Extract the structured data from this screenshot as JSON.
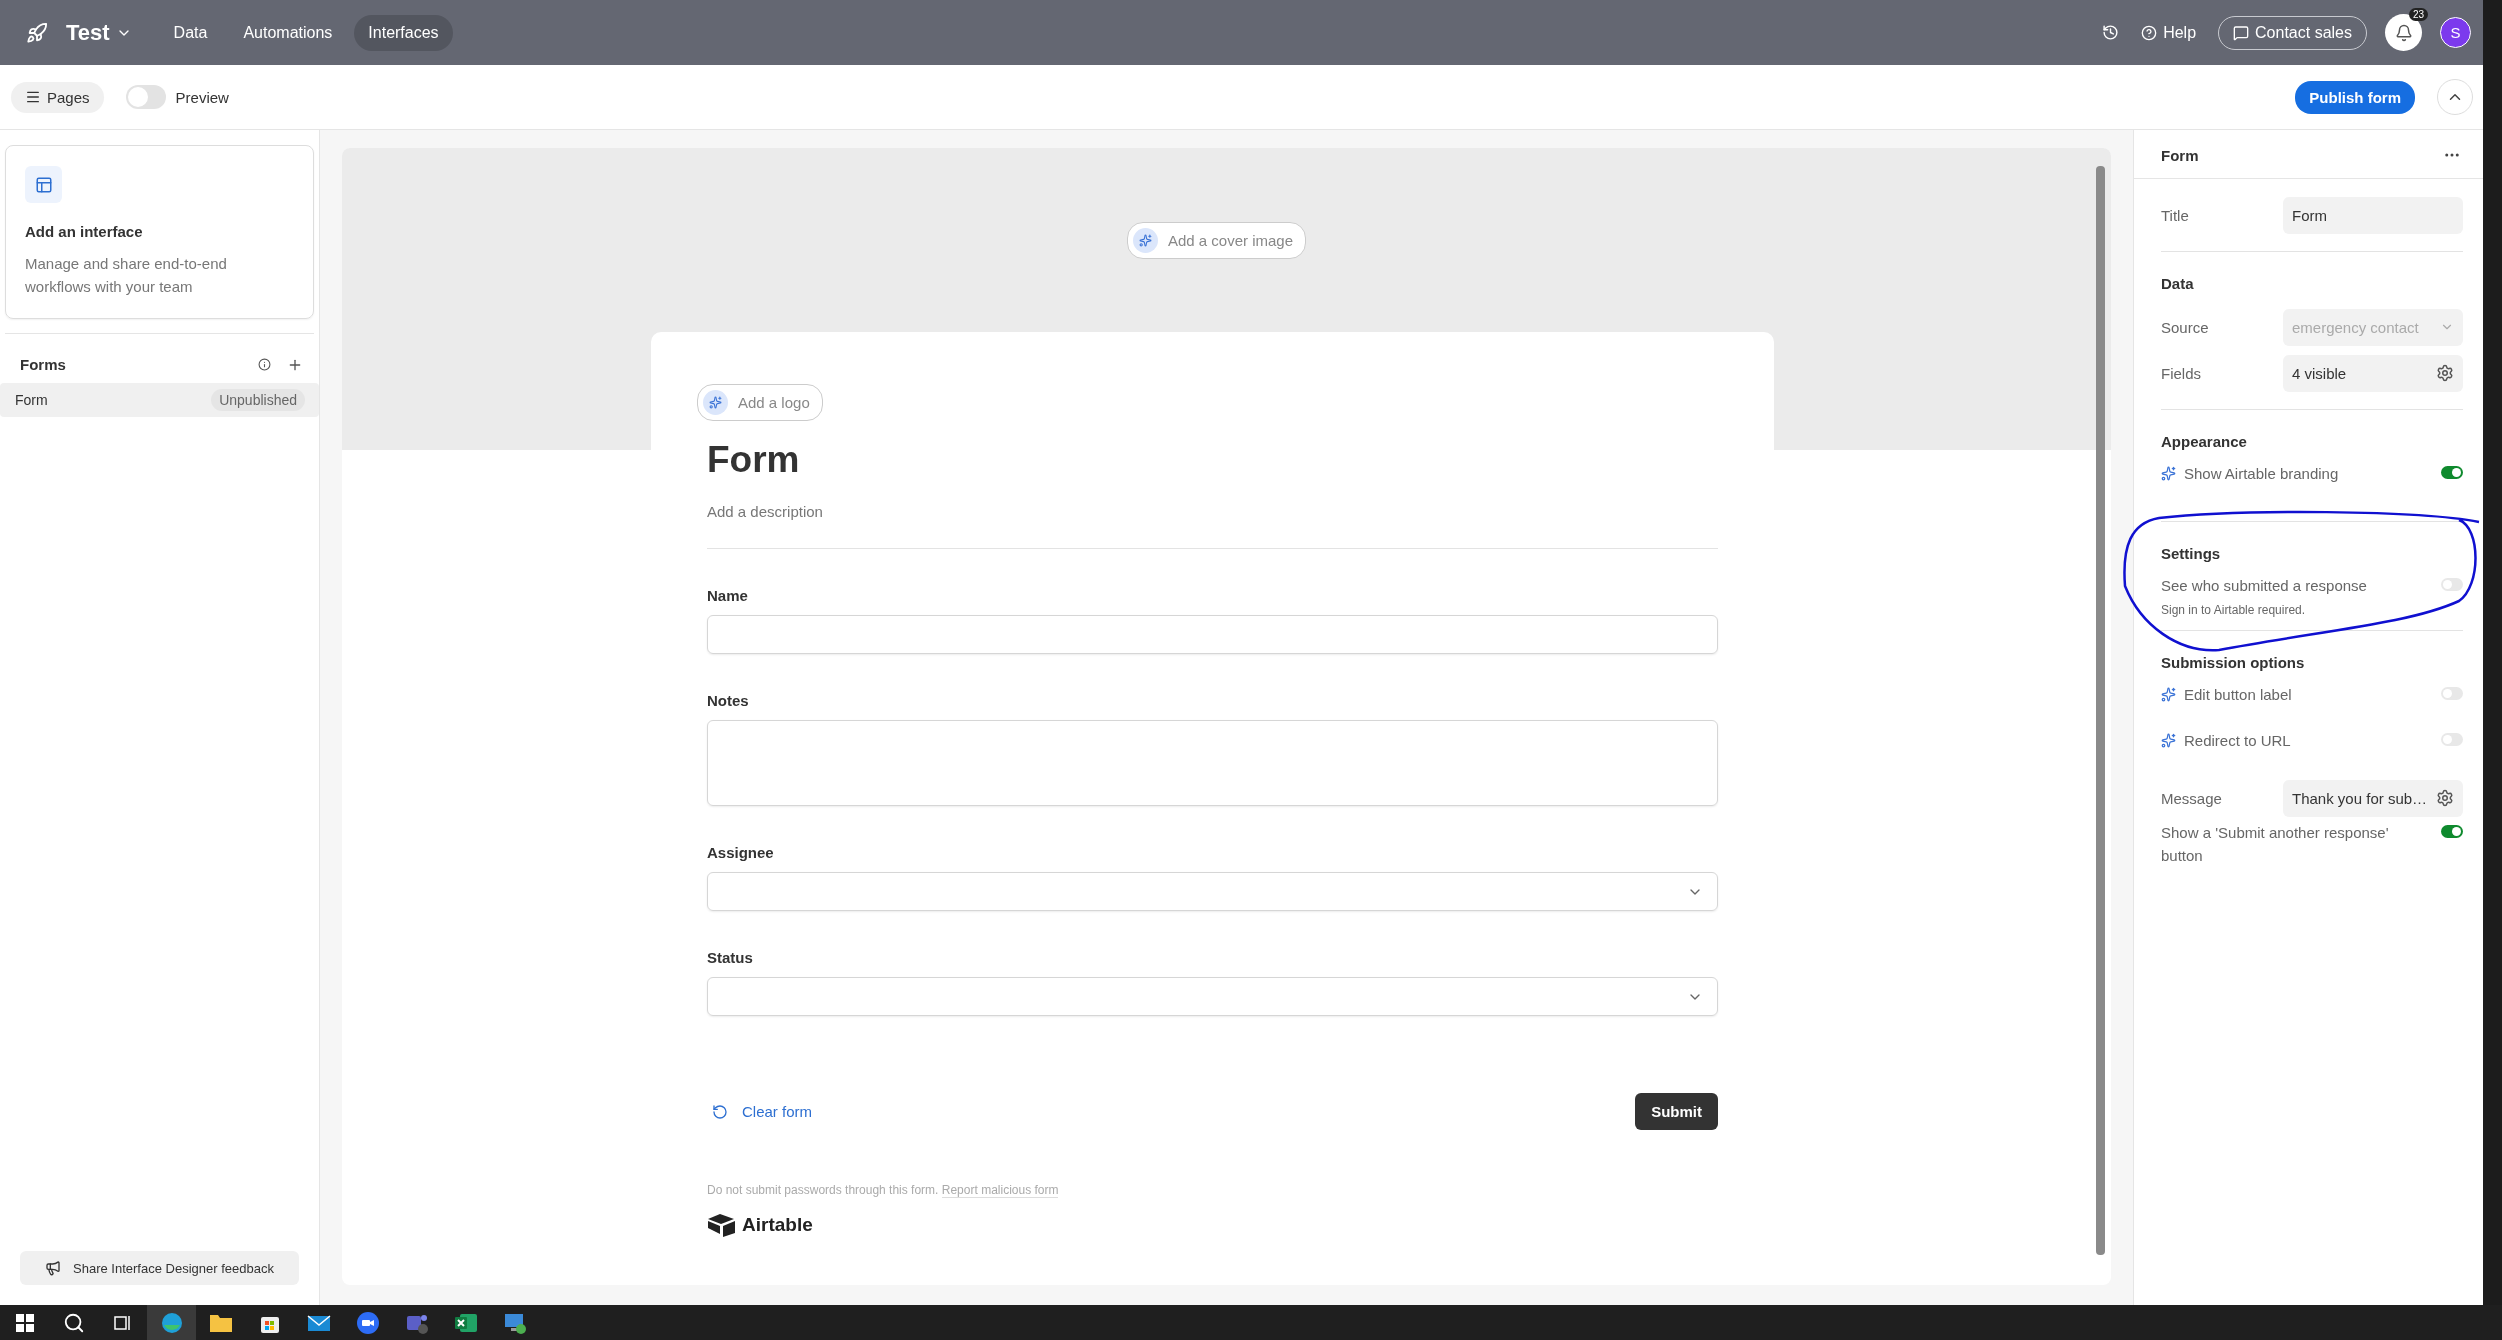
{
  "topbar": {
    "base_name": "Test",
    "nav": [
      {
        "label": "Data",
        "selected": false
      },
      {
        "label": "Automations",
        "selected": false
      },
      {
        "label": "Interfaces",
        "selected": true
      }
    ],
    "help": "Help",
    "contact": "Contact sales",
    "notification_count": "23",
    "avatar": "S"
  },
  "toolbar": {
    "pages": "Pages",
    "preview": {
      "label": "Preview",
      "on": false
    },
    "publish": "Publish form"
  },
  "sidebar": {
    "promo": {
      "title": "Add an interface",
      "text": "Manage and share end-to-end workflows with your team"
    },
    "section": "Forms",
    "items": [
      {
        "label": "Form",
        "badge": "Unpublished",
        "selected": true
      }
    ],
    "feedback": "Share Interface Designer feedback"
  },
  "form": {
    "cover": "Add a cover image",
    "logo": "Add a logo",
    "title": "Form",
    "description": "Add a description",
    "fields": [
      {
        "label": "Name",
        "kind": "text"
      },
      {
        "label": "Notes",
        "kind": "textarea"
      },
      {
        "label": "Assignee",
        "kind": "select"
      },
      {
        "label": "Status",
        "kind": "select"
      }
    ],
    "clear": "Clear form",
    "submit": "Submit",
    "disclaimer": "Do not submit passwords through this form.",
    "report": "Report malicious form",
    "brand": "Airtable"
  },
  "panel": {
    "title": "Form",
    "sections": [
      {
        "rows": [
          {
            "kind": "text",
            "label": "Title",
            "value": "Form"
          }
        ]
      },
      {
        "heading": "Data",
        "rows": [
          {
            "kind": "select",
            "label": "Source",
            "value": "emergency contact",
            "disabled": true
          },
          {
            "kind": "gear",
            "label": "Fields",
            "value": "4 visible"
          }
        ]
      },
      {
        "heading": "Appearance",
        "rows": [
          {
            "kind": "toggle",
            "label": "Show Airtable branding",
            "sparkle": true,
            "on": true
          }
        ]
      },
      {
        "heading": "Settings",
        "annotated": true,
        "rows": [
          {
            "kind": "toggle",
            "label": "See who submitted a response",
            "note": "Sign in to Airtable required.",
            "sparkle": false,
            "on": false
          }
        ]
      },
      {
        "heading": "Submission options",
        "rows": [
          {
            "kind": "toggle",
            "label": "Edit button label",
            "sparkle": true,
            "on": false
          },
          {
            "kind": "toggle",
            "label": "Redirect to URL",
            "sparkle": true,
            "on": false
          },
          {
            "kind": "gear",
            "label": "Message",
            "value": "Thank you for sub…"
          },
          {
            "kind": "toggle",
            "label": "Show a 'Submit another response' button",
            "sparkle": false,
            "on": true
          }
        ]
      }
    ]
  }
}
